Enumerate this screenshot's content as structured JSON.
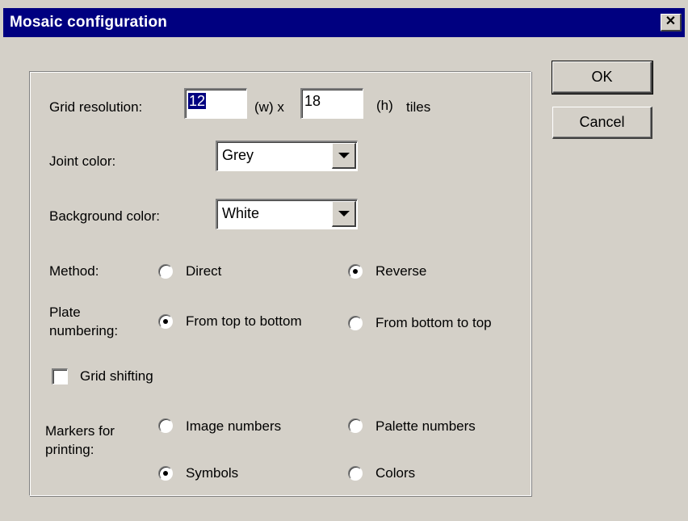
{
  "window": {
    "title": "Mosaic configuration",
    "close_glyph": "✕"
  },
  "buttons": {
    "ok": "OK",
    "cancel": "Cancel"
  },
  "grid": {
    "label": "Grid resolution:",
    "width_value": "12",
    "width_unit": "(w) x",
    "height_value": "18",
    "height_unit": "(h)",
    "suffix": "tiles"
  },
  "joint_color": {
    "label": "Joint color:",
    "value": "Grey"
  },
  "background_color": {
    "label": "Background color:",
    "value": "White"
  },
  "method": {
    "label": "Method:",
    "options": [
      {
        "label": "Direct",
        "checked": false
      },
      {
        "label": "Reverse",
        "checked": true
      }
    ]
  },
  "plate_numbering": {
    "label_line1": "Plate",
    "label_line2": "numbering:",
    "options": [
      {
        "label": "From top to bottom",
        "checked": true
      },
      {
        "label": "From bottom to top",
        "checked": false
      }
    ]
  },
  "grid_shifting": {
    "label": "Grid shifting",
    "checked": false
  },
  "markers": {
    "label_line1": "Markers for",
    "label_line2": "printing:",
    "options": [
      {
        "label": "Image numbers",
        "checked": false
      },
      {
        "label": "Palette numbers",
        "checked": false
      },
      {
        "label": "Symbols",
        "checked": true
      },
      {
        "label": "Colors",
        "checked": false
      }
    ]
  },
  "icons": {
    "close": "close-icon",
    "dropdown": "chevron-down-icon"
  },
  "colors": {
    "titlebar": "#000080",
    "face": "#d4d0c8",
    "selection": "#000080"
  }
}
